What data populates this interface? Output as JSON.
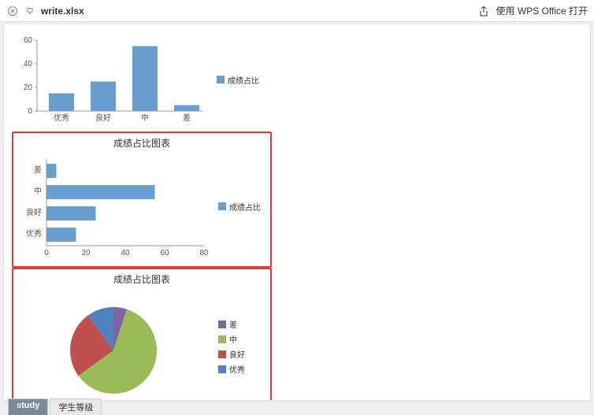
{
  "header": {
    "filename": "write.xlsx",
    "open_with": "使用 WPS Office 打开"
  },
  "legend_label": "成绩占比",
  "chart1_title": "",
  "chart2_title": "成绩占比图表",
  "chart3_title": "成绩占比图表",
  "tabs": {
    "active": "study",
    "other": "学生等级"
  },
  "chart_data": [
    {
      "type": "bar",
      "orientation": "vertical",
      "categories": [
        "优秀",
        "良好",
        "中",
        "差"
      ],
      "values": [
        15,
        25,
        55,
        5
      ],
      "series_name": "成绩占比",
      "ylim": [
        0,
        60
      ],
      "yticks": [
        0,
        20,
        40,
        60
      ],
      "xlabel": "",
      "ylabel": "",
      "title": ""
    },
    {
      "type": "bar",
      "orientation": "horizontal",
      "categories": [
        "差",
        "中",
        "良好",
        "优秀"
      ],
      "values": [
        5,
        55,
        25,
        15
      ],
      "series_name": "成绩占比",
      "xlim": [
        0,
        80
      ],
      "xticks": [
        0,
        20,
        40,
        60,
        80
      ],
      "xlabel": "",
      "ylabel": "",
      "title": "成绩占比图表"
    },
    {
      "type": "pie",
      "categories": [
        "差",
        "中",
        "良好",
        "优秀"
      ],
      "values": [
        5,
        55,
        25,
        15
      ],
      "colors": [
        "#8064a2",
        "#9bbb59",
        "#c0504d",
        "#4f81bd"
      ],
      "title": "成绩占比图表"
    }
  ],
  "colors": {
    "bar": "#6a9ecf",
    "pie": {
      "差": "#8064a2",
      "中": "#9bbb59",
      "良好": "#c0504d",
      "优秀": "#4f81bd"
    }
  }
}
